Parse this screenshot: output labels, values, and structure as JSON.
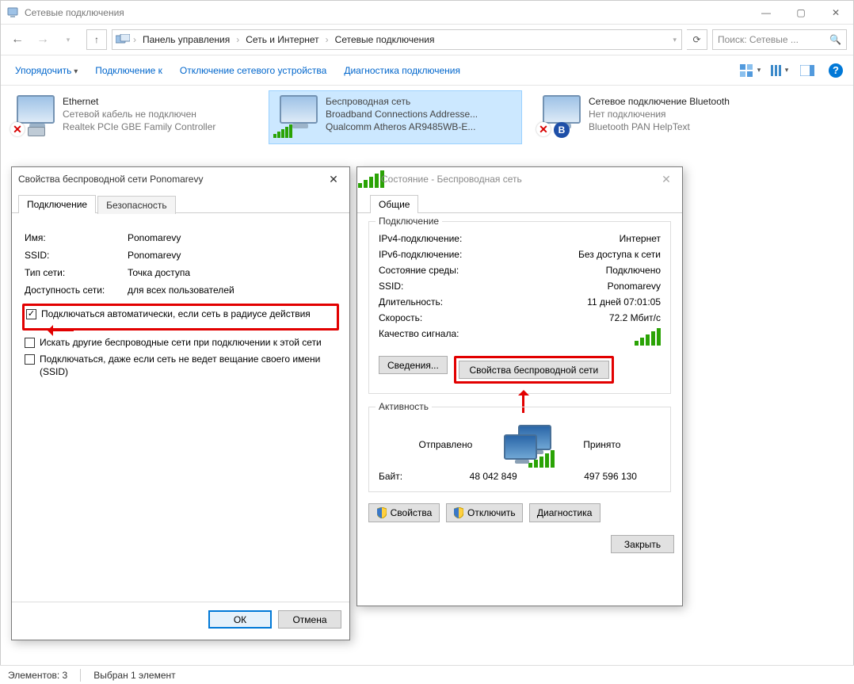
{
  "window": {
    "title": "Сетевые подключения",
    "controls": {
      "min": "—",
      "max": "▢",
      "close": "✕"
    }
  },
  "breadcrumb": {
    "seg1": "Панель управления",
    "seg2": "Сеть и Интернет",
    "seg3": "Сетевые подключения"
  },
  "search": {
    "placeholder": "Поиск: Сетевые ..."
  },
  "toolbar": {
    "organize": "Упорядочить",
    "connect": "Подключение к",
    "disable": "Отключение сетевого устройства",
    "diag": "Диагностика подключения"
  },
  "connections": {
    "eth": {
      "title": "Ethernet",
      "line2": "Сетевой кабель не подключен",
      "line3": "Realtek PCIe GBE Family Controller"
    },
    "wifi": {
      "title": "Беспроводная сеть",
      "line2": "Broadband Connections Addresse...",
      "line3": "Qualcomm Atheros AR9485WB-E..."
    },
    "bt": {
      "title": "Сетевое подключение Bluetooth",
      "line2": "Нет подключения",
      "line3": "Bluetooth PAN HelpText"
    }
  },
  "dlg1": {
    "title": "Свойства беспроводной сети Ponomarevy",
    "tab1": "Подключение",
    "tab2": "Безопасность",
    "name_k": "Имя:",
    "name_v": "Ponomarevy",
    "ssid_k": "SSID:",
    "ssid_v": "Ponomarevy",
    "type_k": "Тип сети:",
    "type_v": "Точка доступа",
    "avail_k": "Доступность сети:",
    "avail_v": "для всех пользователей",
    "chk1": "Подключаться автоматически, если сеть в радиусе действия",
    "chk2": "Искать другие беспроводные сети при подключении к этой сети",
    "chk3": "Подключаться, даже если сеть не ведет вещание своего имени (SSID)",
    "ok": "ОК",
    "cancel": "Отмена"
  },
  "dlg2": {
    "title": "Состояние - Беспроводная сеть",
    "tab1": "Общие",
    "grp1": "Подключение",
    "ipv4_k": "IPv4-подключение:",
    "ipv4_v": "Интернет",
    "ipv6_k": "IPv6-подключение:",
    "ipv6_v": "Без доступа к сети",
    "state_k": "Состояние среды:",
    "state_v": "Подключено",
    "ssid_k": "SSID:",
    "ssid_v": "Ponomarevy",
    "dur_k": "Длительность:",
    "dur_v": "11 дней 07:01:05",
    "speed_k": "Скорость:",
    "speed_v": "72.2 Мбит/с",
    "quality_k": "Качество сигнала:",
    "details": "Сведения...",
    "wprops": "Свойства беспроводной сети",
    "grp2": "Активность",
    "sent": "Отправлено",
    "recv": "Принято",
    "bytes_k": "Байт:",
    "bytes_sent": "48 042 849",
    "bytes_recv": "497 596 130",
    "props": "Свойства",
    "disable": "Отключить",
    "diag": "Диагностика",
    "close": "Закрыть"
  },
  "statusbar": {
    "items": "Элементов: 3",
    "selected": "Выбран 1 элемент"
  }
}
